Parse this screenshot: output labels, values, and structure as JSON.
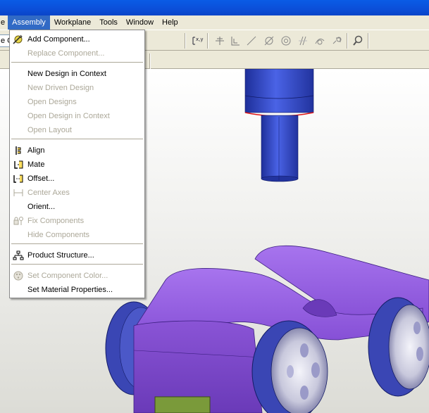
{
  "menubar": {
    "items": [
      {
        "label": "e",
        "active": false
      },
      {
        "label": "Assembly",
        "active": true
      },
      {
        "label": "Workplane",
        "active": false
      },
      {
        "label": "Tools",
        "active": false
      },
      {
        "label": "Window",
        "active": false
      },
      {
        "label": "Help",
        "active": false
      }
    ]
  },
  "toolbar": {
    "stub_text": "e C",
    "icons": [
      "relations-icon",
      "align-tool-icon",
      "mate-tool-icon",
      "offset-tool-icon",
      "angle-tool-icon",
      "insert-tool-icon",
      "parallel-tool-icon",
      "tangent-tool-icon",
      "link-tool-icon",
      "find-icon"
    ]
  },
  "assembly_menu": {
    "items": [
      {
        "label": "Add Component...",
        "enabled": true,
        "icon": "add-component-icon"
      },
      {
        "label": "Replace Component...",
        "enabled": false,
        "icon": ""
      },
      {
        "label": "New Design in Context",
        "enabled": true,
        "icon": ""
      },
      {
        "label": "New Driven Design",
        "enabled": false,
        "icon": ""
      },
      {
        "label": "Open Designs",
        "enabled": false,
        "icon": ""
      },
      {
        "label": "Open Design in Context",
        "enabled": false,
        "icon": ""
      },
      {
        "label": "Open Layout",
        "enabled": false,
        "icon": ""
      },
      {
        "label": "Align",
        "enabled": true,
        "icon": "align-icon"
      },
      {
        "label": "Mate",
        "enabled": true,
        "icon": "mate-icon"
      },
      {
        "label": "Offset...",
        "enabled": true,
        "icon": "offset-icon"
      },
      {
        "label": "Center Axes",
        "enabled": false,
        "icon": "center-axes-icon"
      },
      {
        "label": "Orient...",
        "enabled": true,
        "icon": ""
      },
      {
        "label": "Fix Components",
        "enabled": false,
        "icon": "fix-components-icon"
      },
      {
        "label": "Hide Components",
        "enabled": false,
        "icon": ""
      },
      {
        "label": "Product Structure...",
        "enabled": true,
        "icon": "product-structure-icon"
      },
      {
        "label": "Set Component Color...",
        "enabled": false,
        "icon": "component-color-icon"
      },
      {
        "label": "Set Material Properties...",
        "enabled": true,
        "icon": ""
      }
    ]
  },
  "colors": {
    "menu_highlight": "#316ac5",
    "shaft_blue": "#2f47c8",
    "body_purple": "#8a52d8",
    "wheel_blue": "#3a46b4",
    "edge_red": "#e01818",
    "foot_green": "#7a9a3a"
  }
}
